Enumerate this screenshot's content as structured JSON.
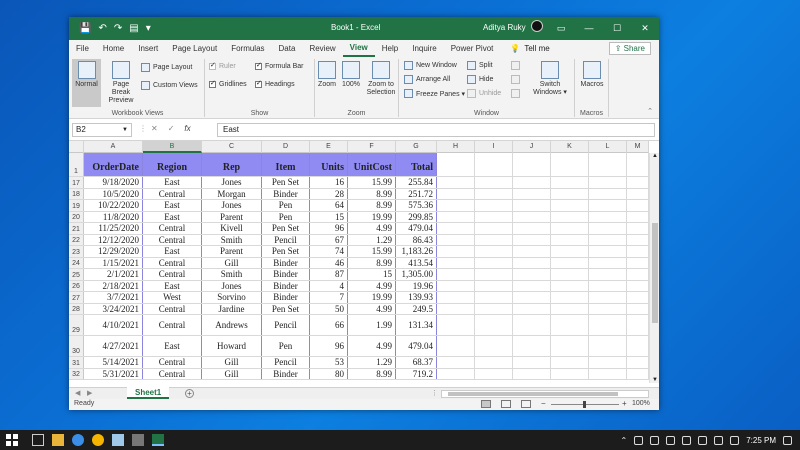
{
  "window": {
    "title": "Book1 - Excel",
    "user": "Aditya Ruky",
    "min": "—",
    "restore": "☐",
    "close": "✕",
    "ribbon_display": "▭"
  },
  "quick_access": {
    "save": "💾",
    "undo": "↶",
    "redo": "↷",
    "form": "▤",
    "more": "▾"
  },
  "tabs": [
    "File",
    "Home",
    "Insert",
    "Page Layout",
    "Formulas",
    "Data",
    "Review",
    "View",
    "Help",
    "Inquire",
    "Power Pivot"
  ],
  "active_tab": "View",
  "tell_me": "Tell me",
  "share": "Share",
  "ribbon": {
    "workbook_views": {
      "label": "Workbook Views",
      "normal": "Normal",
      "page_break": "Page Break Preview",
      "page_layout": "Page Layout",
      "custom_views": "Custom Views"
    },
    "show": {
      "label": "Show",
      "ruler": "Ruler",
      "formula_bar": "Formula Bar",
      "gridlines": "Gridlines",
      "headings": "Headings"
    },
    "zoom": {
      "label": "Zoom",
      "zoom": "Zoom",
      "hundred": "100%",
      "zoom_selection": "Zoom to Selection"
    },
    "window": {
      "label": "Window",
      "new_window": "New Window",
      "arrange_all": "Arrange All",
      "freeze_panes": "Freeze Panes ▾",
      "split": "Split",
      "hide": "Hide",
      "unhide": "Unhide",
      "switch_windows": "Switch Windows ▾"
    },
    "macros": {
      "label": "Macros",
      "macros": "Macros"
    }
  },
  "formula_bar": {
    "name_box": "B2",
    "cancel": "✕",
    "enter": "✓",
    "fx": "fx",
    "value": "East"
  },
  "columns": [
    "A",
    "B",
    "C",
    "D",
    "E",
    "F",
    "G",
    "H",
    "I",
    "J",
    "K",
    "L",
    "M"
  ],
  "header_row": {
    "num": "1",
    "cells": [
      "OrderDate",
      "Region",
      "Rep",
      "Item",
      "Units",
      "UnitCost",
      "Total"
    ]
  },
  "rows": [
    {
      "num": "17",
      "cells": [
        "9/18/2020",
        "East",
        "Jones",
        "Pen Set",
        "16",
        "15.99",
        "255.84"
      ]
    },
    {
      "num": "18",
      "cells": [
        "10/5/2020",
        "Central",
        "Morgan",
        "Binder",
        "28",
        "8.99",
        "251.72"
      ]
    },
    {
      "num": "19",
      "cells": [
        "10/22/2020",
        "East",
        "Jones",
        "Pen",
        "64",
        "8.99",
        "575.36"
      ]
    },
    {
      "num": "20",
      "cells": [
        "11/8/2020",
        "East",
        "Parent",
        "Pen",
        "15",
        "19.99",
        "299.85"
      ]
    },
    {
      "num": "21",
      "cells": [
        "11/25/2020",
        "Central",
        "Kivell",
        "Pen Set",
        "96",
        "4.99",
        "479.04"
      ]
    },
    {
      "num": "22",
      "cells": [
        "12/12/2020",
        "Central",
        "Smith",
        "Pencil",
        "67",
        "1.29",
        "86.43"
      ]
    },
    {
      "num": "23",
      "cells": [
        "12/29/2020",
        "East",
        "Parent",
        "Pen Set",
        "74",
        "15.99",
        "1,183.26"
      ]
    },
    {
      "num": "24",
      "cells": [
        "1/15/2021",
        "Central",
        "Gill",
        "Binder",
        "46",
        "8.99",
        "413.54"
      ]
    },
    {
      "num": "25",
      "cells": [
        "2/1/2021",
        "Central",
        "Smith",
        "Binder",
        "87",
        "15",
        "1,305.00"
      ]
    },
    {
      "num": "26",
      "cells": [
        "2/18/2021",
        "East",
        "Jones",
        "Binder",
        "4",
        "4.99",
        "19.96"
      ]
    },
    {
      "num": "27",
      "cells": [
        "3/7/2021",
        "West",
        "Sorvino",
        "Binder",
        "7",
        "19.99",
        "139.93"
      ]
    },
    {
      "num": "28",
      "cells": [
        "3/24/2021",
        "Central",
        "Jardine",
        "Pen Set",
        "50",
        "4.99",
        "249.5"
      ]
    },
    {
      "num": "29",
      "cells": [
        "4/10/2021",
        "Central",
        "Andrews",
        "Pencil",
        "66",
        "1.99",
        "131.34"
      ]
    },
    {
      "num": "30",
      "cells": [
        "4/27/2021",
        "East",
        "Howard",
        "Pen",
        "96",
        "4.99",
        "479.04"
      ]
    },
    {
      "num": "31",
      "cells": [
        "5/14/2021",
        "Central",
        "Gill",
        "Pencil",
        "53",
        "1.29",
        "68.37"
      ]
    },
    {
      "num": "32",
      "cells": [
        "5/31/2021",
        "Central",
        "Gill",
        "Binder",
        "80",
        "8.99",
        "719.2"
      ]
    }
  ],
  "sheet_tab": "Sheet1",
  "add_sheet": "+",
  "status": {
    "ready": "Ready",
    "zoom": "100%",
    "minus": "−",
    "plus": "+"
  },
  "taskbar": {
    "time": "7:25 PM"
  }
}
